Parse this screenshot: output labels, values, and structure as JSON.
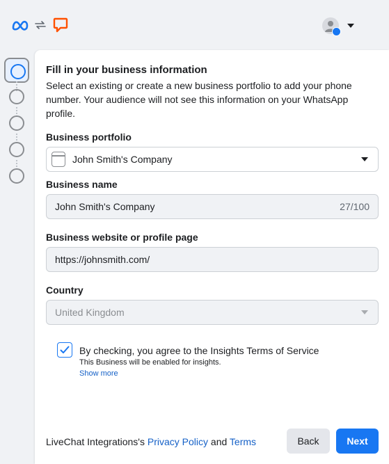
{
  "header": {
    "logos": [
      "meta-logo-icon",
      "sync-arrows-icon",
      "livechat-logo-icon"
    ],
    "profile_icon": "profile-avatar-icon",
    "colors": {
      "meta_blue": "#1877f2",
      "livechat_orange": "#ff5100"
    }
  },
  "stepper": {
    "steps": 5,
    "active_step": 1
  },
  "form": {
    "heading": "Fill in your business information",
    "description": "Select an existing or create a new business portfolio to add your phone number. Your audience will not see this information on your WhatsApp profile.",
    "portfolio": {
      "label": "Business portfolio",
      "value": "John Smith's Company"
    },
    "business_name": {
      "label": "Business name",
      "value": "John Smith's Company",
      "count": "27/100"
    },
    "website": {
      "label": "Business website or profile page",
      "value": "https://johnsmith.com/"
    },
    "country": {
      "label": "Country",
      "value": "United Kingdom"
    },
    "consent": {
      "checked": true,
      "text": "By checking, you agree to the Insights Terms of Service",
      "subtext": "This Business will be enabled for insights.",
      "show_more": "Show more"
    }
  },
  "footer": {
    "prefix": "LiveChat Integrations's",
    "privacy_link": "Privacy Policy",
    "and": "and",
    "terms_link": "Terms",
    "back_label": "Back",
    "next_label": "Next"
  }
}
